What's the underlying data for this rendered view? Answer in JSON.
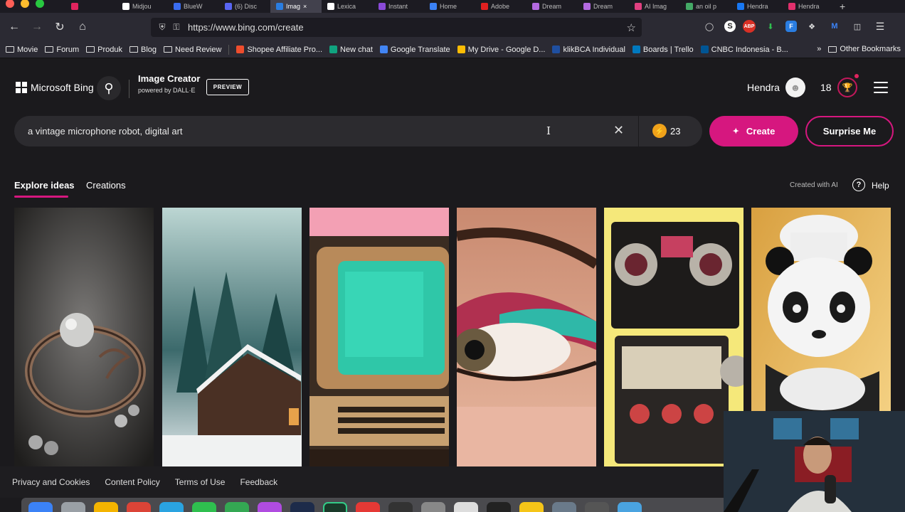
{
  "browser": {
    "tabs": [
      {
        "label": "",
        "color": "#e0245e"
      },
      {
        "label": "Midjou",
        "color": "#ffffff"
      },
      {
        "label": "BlueW",
        "color": "#3a6df0"
      },
      {
        "label": "(6) Disc",
        "color": "#5865f2"
      },
      {
        "label": "Imag",
        "color": "#2a7de1",
        "active": true
      },
      {
        "label": "Lexica",
        "color": "#ffffff"
      },
      {
        "label": "Instant",
        "color": "#8a4ad8"
      },
      {
        "label": "Home",
        "color": "#3b82f6"
      },
      {
        "label": "Adobe",
        "color": "#e02020"
      },
      {
        "label": "Dream",
        "color": "#b36ae0"
      },
      {
        "label": "Dream",
        "color": "#b36ae0"
      },
      {
        "label": "AI Imag",
        "color": "#e04080"
      },
      {
        "label": "an oil p",
        "color": "#44aa66"
      },
      {
        "label": "Hendra",
        "color": "#1877f2"
      },
      {
        "label": "Hendra",
        "color": "#e1306c"
      }
    ],
    "url": "https://www.bing.com/create",
    "bookmarks": [
      {
        "label": "Movie",
        "type": "folder"
      },
      {
        "label": "Forum",
        "type": "folder"
      },
      {
        "label": "Produk",
        "type": "folder"
      },
      {
        "label": "Blog",
        "type": "folder"
      },
      {
        "label": "Need Review",
        "type": "folder"
      },
      {
        "label": "Shopee Affiliate Pro...",
        "type": "site",
        "color": "#ee4d2d"
      },
      {
        "label": "New chat",
        "type": "site",
        "color": "#10a37f"
      },
      {
        "label": "Google Translate",
        "type": "site",
        "color": "#4285f4"
      },
      {
        "label": "My Drive - Google D...",
        "type": "site",
        "color": "#fbbc04"
      },
      {
        "label": "klikBCA Individual",
        "type": "site",
        "color": "#1f4fa0"
      },
      {
        "label": "Boards | Trello",
        "type": "site",
        "color": "#0079bf"
      },
      {
        "label": "CNBC Indonesia - B...",
        "type": "site",
        "color": "#005594"
      }
    ],
    "other_bookmarks": "Other Bookmarks"
  },
  "header": {
    "brand": "Microsoft Bing",
    "product_title": "Image Creator",
    "product_sub": "powered by DALL·E",
    "badge": "PREVIEW",
    "username": "Hendra",
    "rewards_count": "18"
  },
  "prompt": {
    "value": "a vintage microphone robot, digital art",
    "boost_count": "23",
    "create_label": "Create",
    "surprise_label": "Surprise Me"
  },
  "tabs": {
    "explore": "Explore ideas",
    "creations": "Creations",
    "created_with_ai": "Created with AI",
    "help": "Help"
  },
  "gallery": [
    {
      "subject": "pearl ring"
    },
    {
      "subject": "snowy cabin"
    },
    {
      "subject": "retro computer"
    },
    {
      "subject": "eye makeup"
    },
    {
      "subject": "boombox robot"
    },
    {
      "subject": "panda chef"
    }
  ],
  "footer": {
    "links": [
      "Privacy and Cookies",
      "Content Policy",
      "Terms of Use",
      "Feedback"
    ]
  },
  "colors": {
    "accent": "#d6177f",
    "page_bg": "#1b1a1d",
    "boost": "#f0a21a"
  }
}
